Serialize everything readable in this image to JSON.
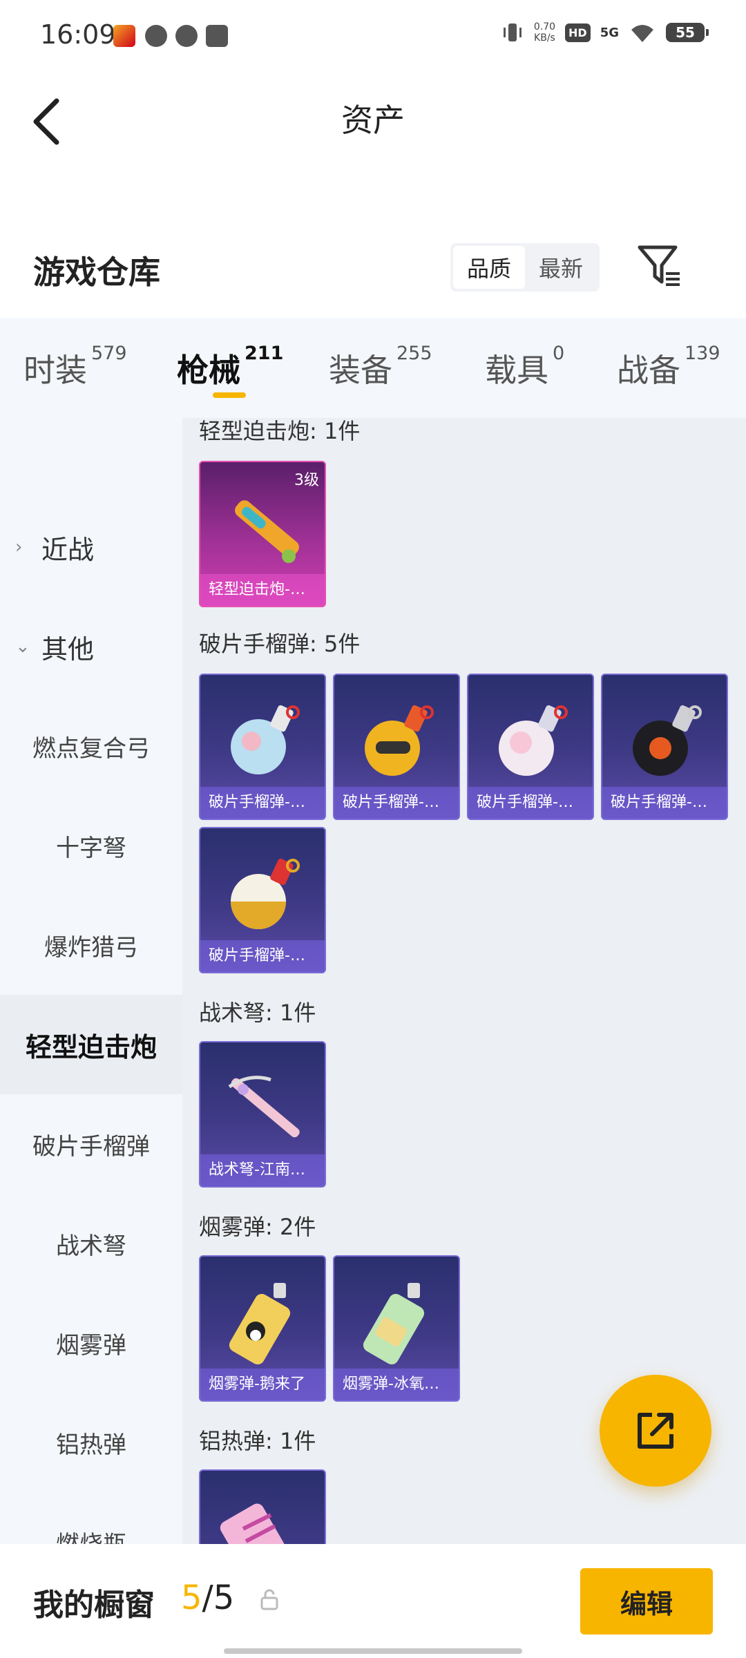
{
  "status_bar": {
    "time": "16:09",
    "net_speed_top": "0.70",
    "net_speed_bottom": "KB/s",
    "hd": "HD",
    "signal": "5G",
    "battery": "55"
  },
  "header": {
    "title": "资产"
  },
  "warehouse": {
    "title": "游戏仓库",
    "sort": [
      "品质",
      "最新"
    ]
  },
  "tabs": [
    {
      "label": "时装",
      "count": "579"
    },
    {
      "label": "枪械",
      "count": "211"
    },
    {
      "label": "装备",
      "count": "255"
    },
    {
      "label": "载具",
      "count": "0"
    },
    {
      "label": "战备",
      "count": "139"
    }
  ],
  "sidebar": {
    "items": [
      {
        "label": "近战"
      },
      {
        "label": "其他"
      },
      {
        "label": "燃点复合弓"
      },
      {
        "label": "十字弩"
      },
      {
        "label": "爆炸猎弓"
      },
      {
        "label": "轻型迫击炮"
      },
      {
        "label": "破片手榴弹"
      },
      {
        "label": "战术弩"
      },
      {
        "label": "烟雾弹"
      },
      {
        "label": "铝热弹"
      },
      {
        "label": "燃烧瓶"
      }
    ]
  },
  "sections": [
    {
      "label": "轻型迫击炮: 1件",
      "items": [
        {
          "name": "轻型迫击炮-…",
          "level": "3级"
        }
      ]
    },
    {
      "label": "破片手榴弹: 5件",
      "items": [
        {
          "name": "破片手榴弹-…"
        },
        {
          "name": "破片手榴弹-…"
        },
        {
          "name": "破片手榴弹-…"
        },
        {
          "name": "破片手榴弹-…"
        },
        {
          "name": "破片手榴弹-…"
        }
      ]
    },
    {
      "label": "战术弩: 1件",
      "items": [
        {
          "name": "战术弩-江南…"
        }
      ]
    },
    {
      "label": "烟雾弹: 2件",
      "items": [
        {
          "name": "烟雾弹-鹅来了"
        },
        {
          "name": "烟雾弹-冰氧…"
        }
      ]
    },
    {
      "label": "铝热弹: 1件",
      "items": [
        {
          "name": ""
        }
      ]
    }
  ],
  "bottom": {
    "title": "我的橱窗",
    "current": "5",
    "separator": "/",
    "total": "5",
    "edit_label": "编辑"
  },
  "colors": {
    "accent": "#f7b500",
    "epic": "#7a6bd6",
    "legendary": "#e64fb4"
  }
}
